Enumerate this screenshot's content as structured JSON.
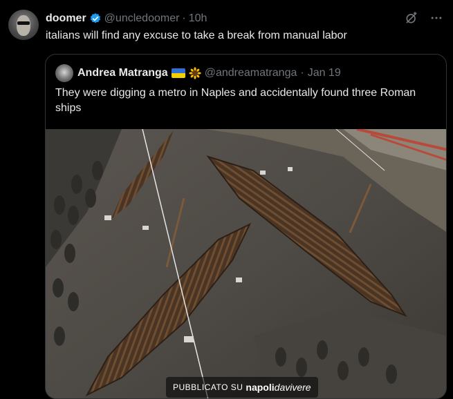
{
  "tweet": {
    "author_name": "doomer",
    "handle": "@uncledoomer",
    "separator": "·",
    "time": "10h",
    "text": "italians will find any excuse to take a break from manual labor",
    "verified": true
  },
  "quoted_tweet": {
    "author_name": "Andrea Matranga",
    "emojis": [
      "ukraine-flag",
      "sunflower"
    ],
    "handle": "@andreamatranga",
    "separator": "·",
    "time": "Jan 19",
    "text": "They were digging a metro in Naples and accidentally found three Roman ships"
  },
  "image": {
    "description_icon": "photo",
    "watermark": {
      "prefix": "PUBBLICATO SU",
      "brand_bold": "napoli",
      "brand_light": "davivere"
    }
  },
  "icons": {
    "verified": "verified-badge-icon",
    "grok": "grok-icon",
    "more": "more-icon"
  },
  "colors": {
    "background": "#000000",
    "text_primary": "#e7e9ea",
    "text_secondary": "#71767b",
    "verified_blue": "#1d9bf0",
    "border": "#2f3336"
  }
}
